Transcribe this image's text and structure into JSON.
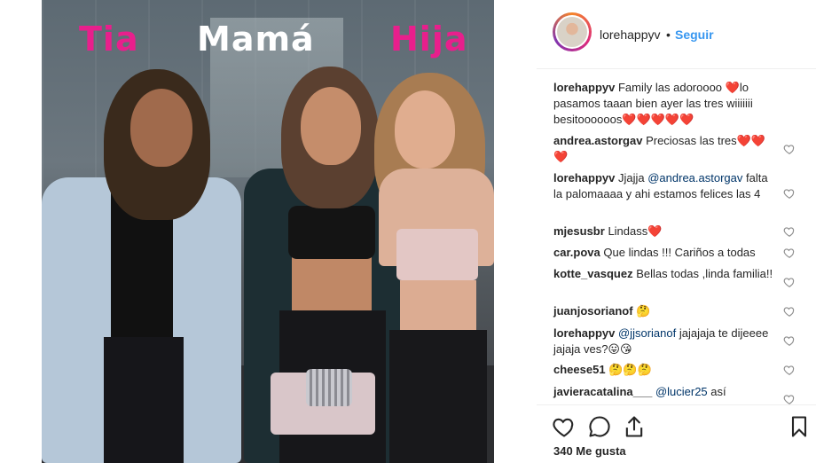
{
  "photo": {
    "captions": {
      "left": "Tia",
      "center": "Mamá",
      "right": "Hija"
    }
  },
  "header": {
    "username": "lorehappyv",
    "separator": "•",
    "follow_label": "Seguir"
  },
  "comments": [
    {
      "user": "lorehappyv",
      "pre": "",
      "mention": "",
      "text": "Family las adoroooo ❤️lo pasamos taaan bien ayer las tres wiiiiiii besitoooooos❤️❤️❤️❤️❤️",
      "like": false
    },
    {
      "user": "andrea.astorgav",
      "pre": "",
      "mention": "",
      "text": "Preciosas las tres❤️❤️❤️",
      "like": true
    },
    {
      "user": "lorehappyv",
      "pre": "Jjajja ",
      "mention": "@andrea.astorgav",
      "text": " falta la palomaaaa y ahi estamos felices las 4",
      "like": true
    },
    {
      "user": "mjesusbr",
      "pre": "",
      "mention": "",
      "text": "Lindass❤️",
      "like": true
    },
    {
      "user": "car.pova",
      "pre": "",
      "mention": "",
      "text": "Que lindas !!! Cariños a todas",
      "like": true
    },
    {
      "user": "kotte_vasquez",
      "pre": "",
      "mention": "",
      "text": "Bellas todas ,linda familia!!",
      "like": true
    },
    {
      "user": "juanjosorianof",
      "pre": "",
      "mention": "",
      "text": "🤔",
      "like": true
    },
    {
      "user": "lorehappyv",
      "pre": "",
      "mention": "@jjsorianof",
      "text": " jajajaja te dijeeee jajaja ves?😛😘",
      "like": true
    },
    {
      "user": "cheese51",
      "pre": "",
      "mention": "",
      "text": "🤔🤔🤔",
      "like": true
    },
    {
      "user": "javieracatalina___",
      "pre": "",
      "mention": "@lucier25",
      "text": " así",
      "like": true
    }
  ],
  "actions": {
    "likes_text": "340 Me gusta"
  },
  "icons": {
    "like": "heart-outline-icon",
    "comment": "speech-bubble-icon",
    "share": "share-icon",
    "save": "bookmark-icon",
    "comment_like": "small-heart-icon"
  },
  "colors": {
    "follow": "#3897f0",
    "mention": "#003569",
    "caption_pink": "#e81f8c"
  }
}
